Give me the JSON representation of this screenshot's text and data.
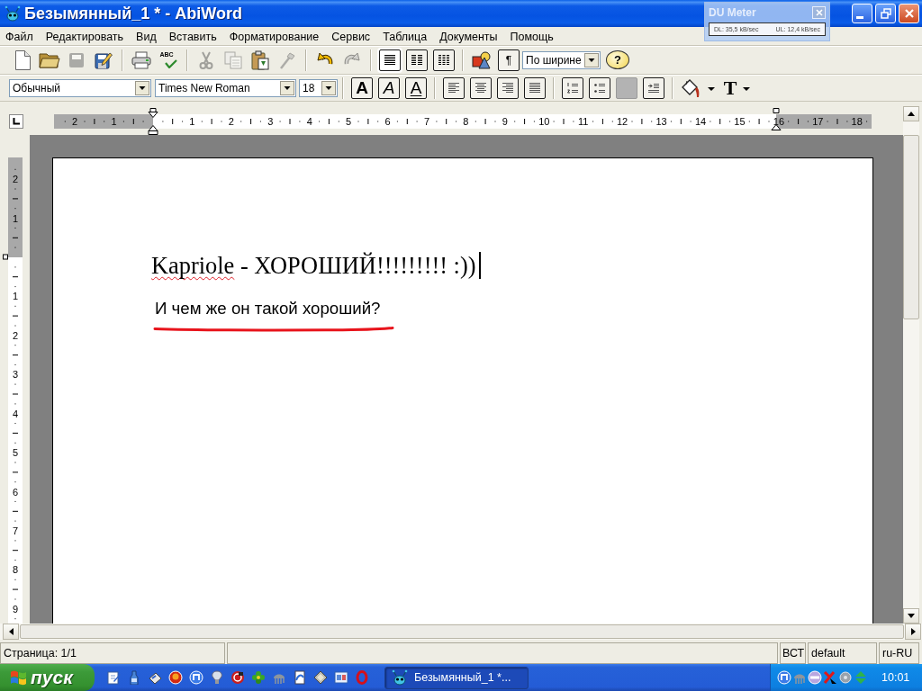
{
  "window": {
    "title": "Безымянный_1 * - AbiWord"
  },
  "du_meter": {
    "title": "DU Meter",
    "readings": [
      "DL: 35,5 kB/sec",
      "UL: 12,4 kB/sec"
    ]
  },
  "menu": [
    "Файл",
    "Редактировать",
    "Вид",
    "Вставить",
    "Форматирование",
    "Сервис",
    "Таблица",
    "Документы",
    "Помощь"
  ],
  "standard_toolbar": [
    {
      "kind": "new",
      "disabled": false
    },
    {
      "kind": "open",
      "disabled": false
    },
    {
      "kind": "save",
      "disabled": true
    },
    {
      "kind": "save_as",
      "disabled": false
    },
    {
      "kind": "separator"
    },
    {
      "kind": "print",
      "disabled": false
    },
    {
      "kind": "spellcheck",
      "label": "ABC",
      "disabled": false
    },
    {
      "kind": "separator"
    },
    {
      "kind": "cut",
      "disabled": true
    },
    {
      "kind": "copy",
      "disabled": true
    },
    {
      "kind": "paste",
      "disabled": false
    },
    {
      "kind": "format_painter",
      "disabled": true
    },
    {
      "kind": "separator"
    },
    {
      "kind": "undo",
      "disabled": false
    },
    {
      "kind": "redo",
      "disabled": true
    },
    {
      "kind": "separator"
    },
    {
      "kind": "columns_1",
      "selected": true
    },
    {
      "kind": "columns_2",
      "selected": false
    },
    {
      "kind": "columns_3",
      "selected": false
    },
    {
      "kind": "separator"
    },
    {
      "kind": "image",
      "disabled": false
    },
    {
      "kind": "show_marks",
      "label": "¶"
    },
    {
      "kind": "zoom",
      "value": "По ширине"
    },
    {
      "kind": "help",
      "label": "?"
    }
  ],
  "format_toolbar": [
    {
      "kind": "style",
      "value": "Обычный"
    },
    {
      "kind": "font",
      "value": "Times New Roman"
    },
    {
      "kind": "size",
      "value": "18"
    },
    {
      "kind": "separator"
    },
    {
      "kind": "bold",
      "label": "A"
    },
    {
      "kind": "italic",
      "label": "A"
    },
    {
      "kind": "underline",
      "label": "A"
    },
    {
      "kind": "separator"
    },
    {
      "kind": "align_left"
    },
    {
      "kind": "align_center"
    },
    {
      "kind": "align_right"
    },
    {
      "kind": "align_justify"
    },
    {
      "kind": "separator"
    },
    {
      "kind": "numbered_list",
      "disabled": false
    },
    {
      "kind": "bulleted_list",
      "disabled": false
    },
    {
      "kind": "blank",
      "disabled": true
    },
    {
      "kind": "indent",
      "disabled": false
    },
    {
      "kind": "separator"
    },
    {
      "kind": "fill_color"
    },
    {
      "kind": "text_color",
      "label": "T"
    }
  ],
  "horizontal_ruler": {
    "left_labels": [
      "2",
      "1"
    ],
    "labels": [
      "1",
      "2",
      "3",
      "4",
      "5",
      "6",
      "7",
      "8",
      "9",
      "10",
      "11",
      "12",
      "13",
      "14",
      "15",
      "16",
      "17",
      "18"
    ]
  },
  "vertical_ruler": {
    "top_labels": [
      "2",
      "1"
    ],
    "labels": [
      "1",
      "2",
      "3",
      "4",
      "5",
      "6",
      "7",
      "8",
      "9"
    ]
  },
  "document": {
    "paragraphs": [
      {
        "kind": "serif",
        "runs": [
          {
            "text": "Kapriole",
            "misspelled": true
          },
          {
            "text": " - ХОРОШИЙ!!!!!!!!! :))",
            "misspelled": false
          }
        ],
        "cursor": true,
        "marked": false
      },
      {
        "kind": "sans",
        "runs": [
          {
            "text": "И чем же он такой хороший?",
            "misspelled": false
          }
        ],
        "cursor": false,
        "marked": true
      }
    ]
  },
  "status_bar": {
    "page": "Страница: 1/1",
    "mode": "ВСТ",
    "style": "default",
    "language": "ru-RU"
  },
  "taskbar": {
    "start": "пуск",
    "tasks": [
      {
        "title": "Безымянный_1 *...",
        "selected": true
      }
    ],
    "clock": "10:01"
  }
}
